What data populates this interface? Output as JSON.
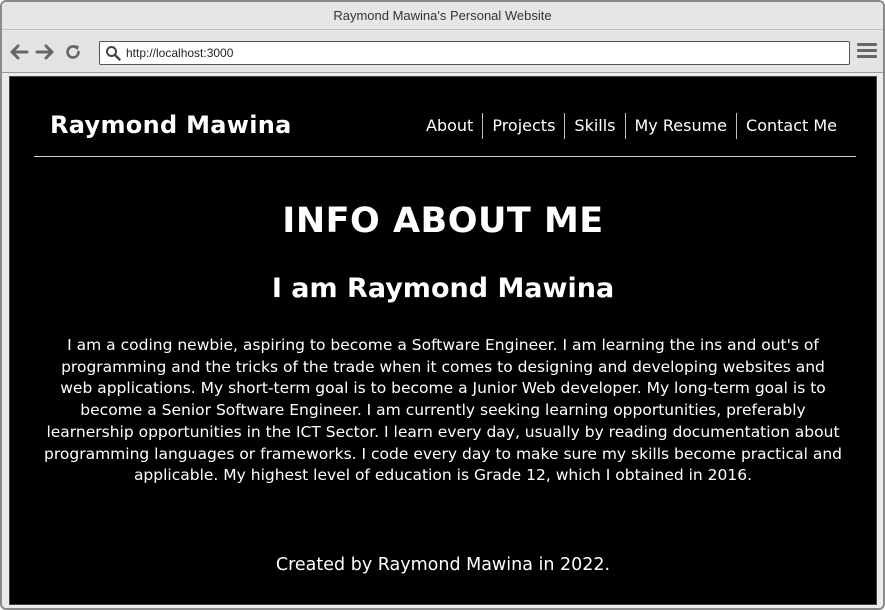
{
  "window": {
    "title": "Raymond Mawina's Personal Website"
  },
  "browser": {
    "url": "http://localhost:3000",
    "icons": [
      "back-arrow-icon",
      "forward-arrow-icon",
      "reload-icon",
      "search-icon",
      "menu-icon"
    ]
  },
  "site": {
    "brand": "Raymond Mawina",
    "nav": [
      {
        "label": "About"
      },
      {
        "label": "Projects"
      },
      {
        "label": "Skills"
      },
      {
        "label": "My Resume"
      },
      {
        "label": "Contact Me"
      }
    ]
  },
  "content": {
    "title": "INFO ABOUT ME",
    "subtitle": "I am Raymond Mawina",
    "bio": "I am a coding newbie, aspiring to become a Software Engineer. I am learning the ins and out's of programming and the tricks of the trade when it comes to designing and developing websites and web applications. My short-term goal is to become a Junior Web developer. My long-term goal is to become a Senior Software Engineer. I am currently seeking learning opportunities, preferably learnership opportunities in the ICT Sector. I learn every day, usually by reading documentation about programming languages or frameworks. I code every day to make sure my skills become practical and applicable. My highest level of education is Grade 12, which I obtained in 2016.",
    "footer": "Created by Raymond Mawina in 2022."
  },
  "colors": {
    "page_bg": "#000000",
    "text": "#ffffff",
    "chrome": "#e4e4e4"
  }
}
